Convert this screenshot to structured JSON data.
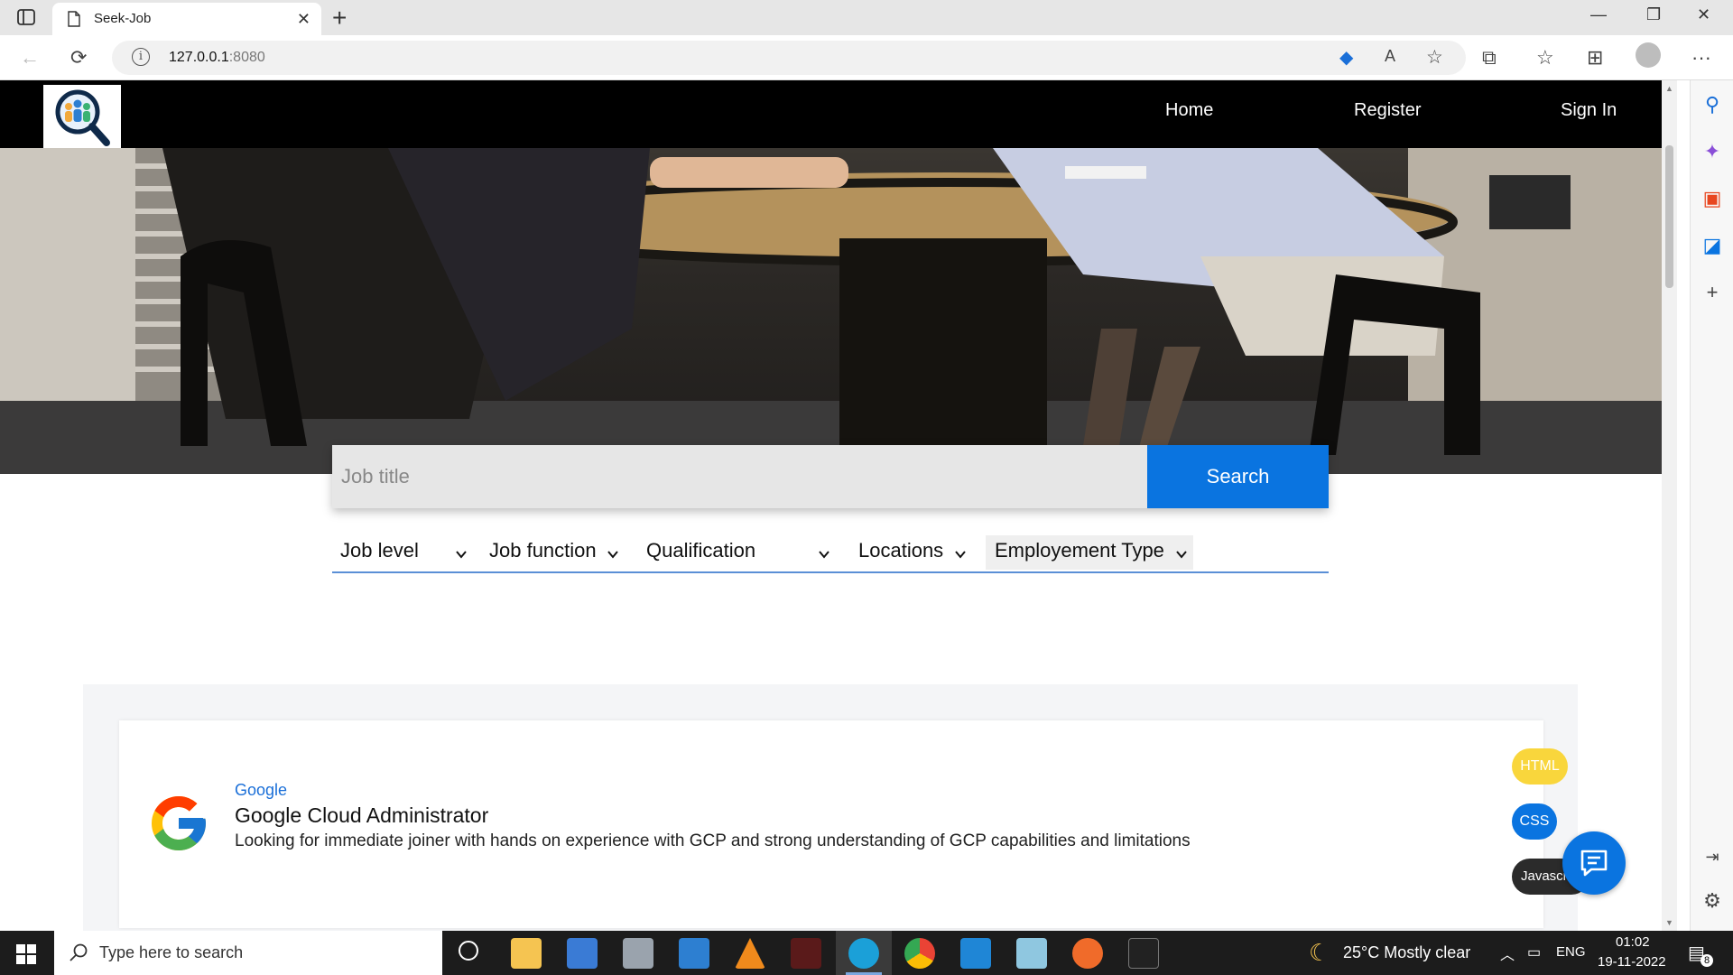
{
  "browser": {
    "tab_title": "Seek-Job",
    "url_host": "127.0.0.1",
    "url_port": ":8080"
  },
  "nav": {
    "links": [
      "Home",
      "Register",
      "Sign In"
    ]
  },
  "search": {
    "placeholder": "Job title",
    "button_label": "Search"
  },
  "filters": [
    "Job level",
    "Job function",
    "Qualification",
    "Locations",
    "Employement Type"
  ],
  "job": {
    "company": "Google",
    "title": "Google Cloud Administrator",
    "description": "Looking for immediate joiner with hands on experience with GCP and strong understanding of GCP capabilities and limitations",
    "tags": [
      {
        "label": "HTML",
        "color": "#f9d63c"
      },
      {
        "label": "CSS",
        "color": "#0a74e0"
      },
      {
        "label": "Javascri",
        "color": "#2b2b2b"
      }
    ]
  },
  "taskbar": {
    "search_placeholder": "Type here to search",
    "weather": "25°C  Mostly clear",
    "language": "ENG",
    "time": "01:02",
    "date": "19-11-2022",
    "notification_count": "8"
  },
  "colors": {
    "accent": "#0a74e0",
    "navbar": "#000000",
    "section_bg": "#f4f5f7"
  }
}
